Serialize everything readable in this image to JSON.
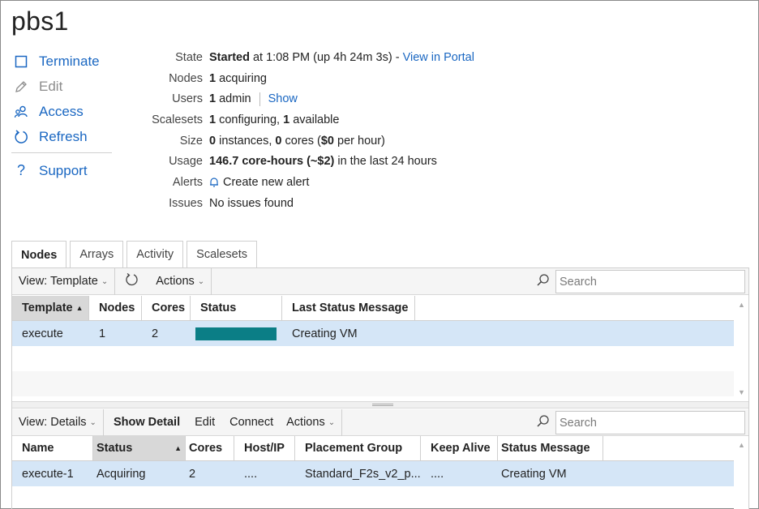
{
  "title": "pbs1",
  "actions": {
    "terminate": "Terminate",
    "edit": "Edit",
    "access": "Access",
    "refresh": "Refresh",
    "support": "Support"
  },
  "info": {
    "state_label": "State",
    "state_value": "Started",
    "state_rest": " at 1:08 PM (up 4h 24m 3s) - ",
    "state_link": "View in Portal",
    "nodes_label": "Nodes",
    "nodes_count": "1",
    "nodes_rest": " acquiring",
    "users_label": "Users",
    "users_count": "1",
    "users_rest": " admin",
    "users_link": "Show",
    "scalesets_label": "Scalesets",
    "scalesets_a": "1",
    "scalesets_b": " configuring, ",
    "scalesets_c": "1",
    "scalesets_d": " available",
    "size_label": "Size",
    "size_a": "0",
    "size_b": " instances, ",
    "size_c": "0",
    "size_d": " cores (",
    "size_e": "$0",
    "size_f": " per hour)",
    "usage_label": "Usage",
    "usage_bold": "146.7 core-hours (~$2)",
    "usage_rest": " in the last 24 hours",
    "alerts_label": "Alerts",
    "alerts_link": "Create new alert",
    "issues_label": "Issues",
    "issues_value": "No issues found"
  },
  "tabs": [
    "Nodes",
    "Arrays",
    "Activity",
    "Scalesets"
  ],
  "top_toolbar": {
    "view": "View: Template",
    "actions": "Actions",
    "search_placeholder": "Search"
  },
  "top_grid": {
    "columns": [
      "Template",
      "Nodes",
      "Cores",
      "Status",
      "Last Status Message"
    ],
    "rows": [
      {
        "template": "execute",
        "nodes": "1",
        "cores": "2",
        "status_fill": 1.0,
        "message": "Creating VM"
      }
    ]
  },
  "bottom_toolbar": {
    "view": "View: Details",
    "show_detail": "Show Detail",
    "edit": "Edit",
    "connect": "Connect",
    "actions": "Actions",
    "search_placeholder": "Search"
  },
  "bottom_grid": {
    "columns": [
      "Name",
      "Status",
      "Cores",
      "Host/IP",
      "Placement Group",
      "Keep Alive",
      "Status Message"
    ],
    "rows": [
      {
        "name": "execute-1",
        "status": "Acquiring",
        "cores": "2",
        "host": "....",
        "placement": "Standard_F2s_v2_p...",
        "keepalive": "....",
        "message": "Creating VM"
      }
    ]
  },
  "colors": {
    "link": "#1a67c2",
    "status_bar": "#0b7e86",
    "selected_row": "#d5e6f7"
  }
}
